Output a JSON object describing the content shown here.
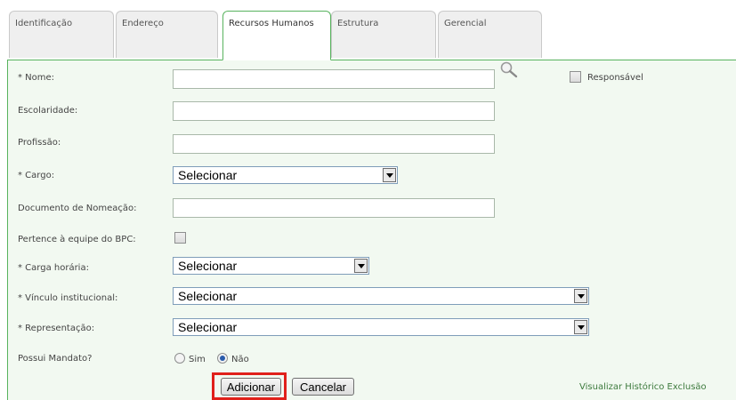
{
  "tabs": [
    {
      "label": "Identificação",
      "active": false
    },
    {
      "label": "Endereço",
      "active": false
    },
    {
      "label": "Recursos Humanos",
      "active": true
    },
    {
      "label": "Estrutura",
      "active": false
    },
    {
      "label": "Gerencial",
      "active": false
    }
  ],
  "form": {
    "nome": {
      "label": "* Nome:",
      "value": ""
    },
    "responsavel": {
      "label": "Responsável",
      "checked": false
    },
    "escolaridade": {
      "label": "Escolaridade:",
      "value": ""
    },
    "profissao": {
      "label": "Profissão:",
      "value": ""
    },
    "cargo": {
      "label": "* Cargo:",
      "selected": "Selecionar"
    },
    "documento_nomeacao": {
      "label": "Documento de Nomeação:",
      "value": ""
    },
    "equipe_bpc": {
      "label": "Pertence à equipe do BPC:",
      "checked": false
    },
    "carga_horaria": {
      "label": "* Carga horária:",
      "selected": "Selecionar"
    },
    "vinculo_institucional": {
      "label": "* Vínculo institucional:",
      "selected": "Selecionar"
    },
    "representacao": {
      "label": "* Representação:",
      "selected": "Selecionar"
    },
    "possui_mandato": {
      "label": "Possui Mandato?",
      "options": [
        {
          "label": "Sim",
          "checked": false
        },
        {
          "label": "Não",
          "checked": true
        }
      ]
    }
  },
  "actions": {
    "adicionar": "Adicionar",
    "cancelar": "Cancelar",
    "historico_link": "Visualizar Histórico Exclusão"
  },
  "colors": {
    "accent_green": "#58b35e",
    "panel_bg": "#f2f9f1",
    "highlight_red": "#e0201b",
    "link_green": "#3d7a3d"
  },
  "icons": {
    "search": "search-icon"
  }
}
